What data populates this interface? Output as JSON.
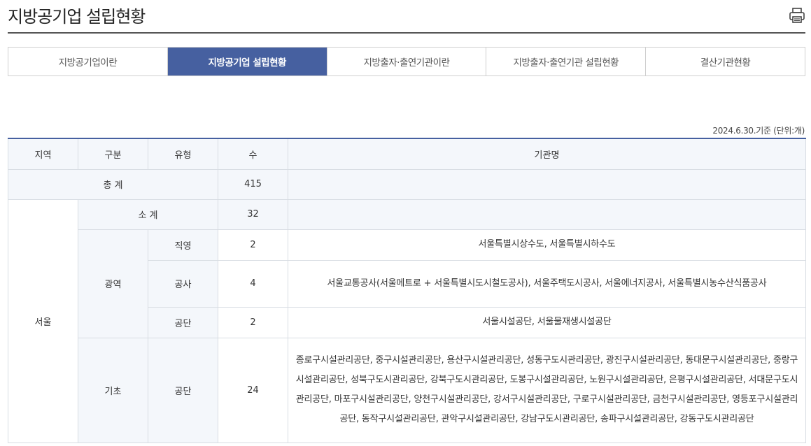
{
  "page": {
    "title": "지방공기업 설립현황"
  },
  "tabs": [
    {
      "label": "지방공기업이란",
      "active": false
    },
    {
      "label": "지방공기업 설립현황",
      "active": true
    },
    {
      "label": "지방출자·출연기관이란",
      "active": false
    },
    {
      "label": "지방출자·출연기관 설립현황",
      "active": false
    },
    {
      "label": "결산기관현황",
      "active": false
    }
  ],
  "note": "2024.6.30.기준 (단위:개)",
  "table": {
    "headers": {
      "region": "지역",
      "category": "구분",
      "type": "유형",
      "count": "수",
      "org": "기관명"
    },
    "total": {
      "label": "총 계",
      "count": "415",
      "org": ""
    },
    "region": "서울",
    "subtotal": {
      "label": "소 계",
      "count": "32",
      "org": ""
    },
    "groups": {
      "metro": "광역",
      "basic": "기초"
    },
    "rows": [
      {
        "type": "직영",
        "count": "2",
        "org": "서울특별시상수도, 서울특별시하수도"
      },
      {
        "type": "공사",
        "count": "4",
        "org": "서울교통공사(서울메트로 + 서울특별시도시철도공사), 서울주택도시공사, 서울에너지공사, 서울특별시농수산식품공사"
      },
      {
        "type": "공단",
        "count": "2",
        "org": "서울시설공단, 서울물재생시설공단"
      },
      {
        "type": "공단",
        "count": "24",
        "org": "종로구시설관리공단, 중구시설관리공단, 용산구시설관리공단, 성동구도시관리공단, 광진구시설관리공단, 동대문구시설관리공단, 중랑구시설관리공단, 성북구도시관리공단, 강북구도시관리공단, 도봉구시설관리공단, 노원구시설관리공단, 은평구시설관리공단, 서대문구도시관리공단, 마포구시설관리공단, 양천구시설관리공단, 강서구시설관리공단, 구로구시설관리공단, 금천구시설관리공단, 영등포구시설관리공단, 동작구시설관리공단, 관악구시설관리공단, 강남구도시관리공단, 송파구시설관리공단, 강동구도시관리공단"
      }
    ]
  },
  "colors": {
    "accent": "#4660a0",
    "header_bg": "#f4f7fb",
    "border": "#d8dde3"
  },
  "icons": {
    "print": "printer-icon"
  }
}
